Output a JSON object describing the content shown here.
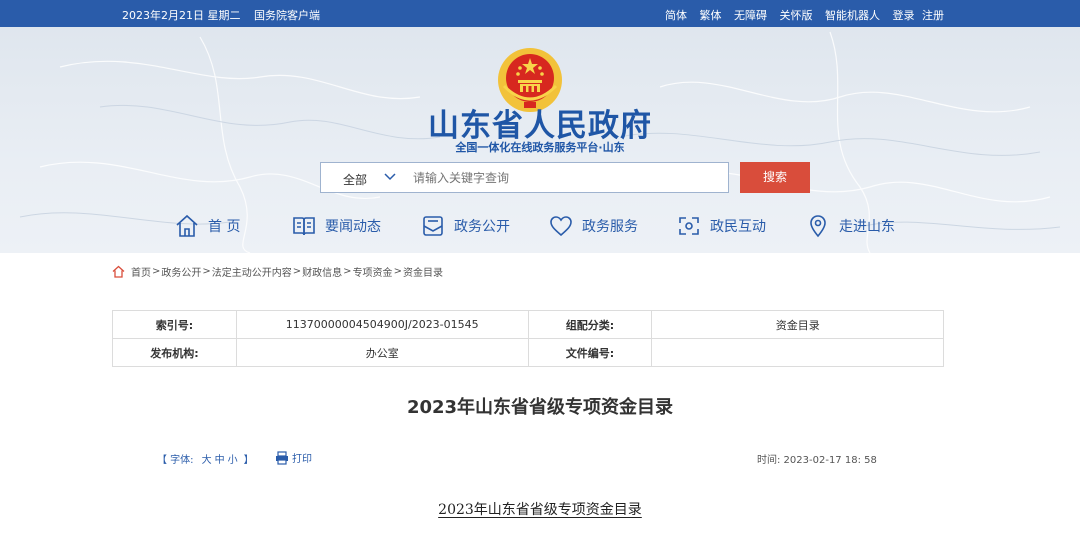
{
  "topbar": {
    "date": "2023年2月21日 星期二",
    "client_link": "国务院客户端",
    "links": [
      "简体",
      "繁体",
      "无障碍",
      "关怀版",
      "智能机器人",
      "登录",
      "注册"
    ]
  },
  "header": {
    "site_title": "山东省人民政府",
    "subtitle": "全国一体化在线政务服务平台·山东"
  },
  "search": {
    "scope": "全部",
    "placeholder": "请输入关键字查询",
    "button": "搜索"
  },
  "nav": [
    {
      "label": "首 页",
      "icon": "home-icon"
    },
    {
      "label": "要闻动态",
      "icon": "book-icon"
    },
    {
      "label": "政务公开",
      "icon": "mailbox-icon"
    },
    {
      "label": "政务服务",
      "icon": "heart-icon"
    },
    {
      "label": "政民互动",
      "icon": "interaction-icon"
    },
    {
      "label": "走进山东",
      "icon": "location-icon"
    }
  ],
  "breadcrumb": [
    "首页",
    "政务公开",
    "法定主动公开内容",
    "财政信息",
    "专项资金",
    "资金目录"
  ],
  "meta": {
    "index_label": "索引号:",
    "index_value": "11370000004504900J/2023-01545",
    "category_label": "组配分类:",
    "category_value": "资金目录",
    "publisher_label": "发布机构:",
    "publisher_value": "办公室",
    "docno_label": "文件编号:",
    "docno_value": ""
  },
  "article": {
    "title": "2023年山东省省级专项资金目录",
    "font_label": "【 字体:",
    "font_sizes": [
      "大",
      "中",
      "小"
    ],
    "font_close": "】",
    "print": "打印",
    "time": "时间: 2023-02-17 18: 58",
    "body_heading": "2023年山东省省级专项资金目录"
  },
  "colors": {
    "brand_blue": "#2a5caa",
    "search_red": "#d94d3b"
  }
}
